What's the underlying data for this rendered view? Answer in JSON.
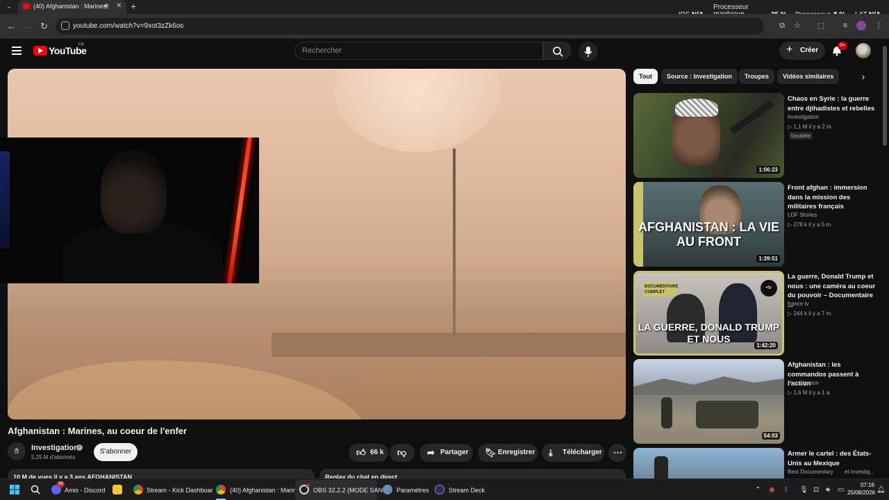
{
  "browser": {
    "tab_title": "(40) Afghanistan : Marines,",
    "url": "youtube.com/watch?v=9xot3zZk6os"
  },
  "perf_overlay": {
    "ips_label": "IPS",
    "ips_value": "N/A",
    "gpu_label_line1": "Processeur",
    "gpu_label_line2": "graphique",
    "gpu_value": "35 %",
    "cpu_label": "Processeur",
    "cpu_value": "8 %",
    "lat_label": "LAT",
    "lat_value": "N/A"
  },
  "youtube": {
    "logo_text": "YouTube",
    "country": "FR",
    "search_placeholder": "Rechercher",
    "create_label": "Créer",
    "notif_badge": "9+"
  },
  "video": {
    "title": "Afghanistan : Marines, au coeur de l'enfer",
    "channel": "Investigation",
    "subscribers": "5,25 M d'abonnés",
    "subscribe_label": "S'abonner",
    "likes": "66 k",
    "share_label": "Partager",
    "save_label": "Enregistrer",
    "download_label": "Télécharger",
    "description_preview": "10 M de vues  il y a 3 ans  AFGHANISTAN",
    "chat_replay": "Replay du chat en direct"
  },
  "chips": [
    "Tout",
    "Source : Investigation",
    "Troupes",
    "Vidéos similaires"
  ],
  "recommendations": [
    {
      "title": "Chaos en Syrie : la guerre entre djihadistes et rebelles",
      "channel": "Investigation",
      "meta": "▷ 1,1 M   il y a 2 m.",
      "badge": "Doublée",
      "duration": "1:06:23"
    },
    {
      "title": "Front afghan : immersion dans la mission des militaires français",
      "channel": "LDF Stories",
      "meta": "▷ 278 k   il y a 5 m.",
      "duration": "1:39:51",
      "thumb_text": "AFGHANISTAN : LA VIE AU FRONT"
    },
    {
      "title": "La guerre, Donald Trump et nous : une caméra au coeur du pouvoir – Documentaire ...",
      "channel": "france tv",
      "meta": "▷ 244 k   il y a 7 m.",
      "duration": "1:42:20",
      "thumb_text": "LA GUERRE, DONALD TRUMP ET NOUS",
      "thumb_tag": "DOCUMENTAIRE COMPLET"
    },
    {
      "title": "Afghanistan : les commandos passent à l'action",
      "channel": "Investigation",
      "meta": "▷ 1,6 M   il y a 1 a",
      "duration": "54:03"
    },
    {
      "title": "Armer le cartel : des États-Unis au Mexique",
      "channel": "Best Documentary",
      "meta": "",
      "duration": ""
    }
  ],
  "rec4_channel_suffix": "et Investig...",
  "taskbar": {
    "items": [
      "Amis - Discord",
      "Stream - Kick Dashboar",
      "(40) Afghanistan : Marin",
      "OBS 32.2.2 (MODE SANS",
      "Paramètres",
      "Stream Deck"
    ],
    "discord_badge": "99",
    "time": "07:16",
    "date": "25/08/2026"
  }
}
